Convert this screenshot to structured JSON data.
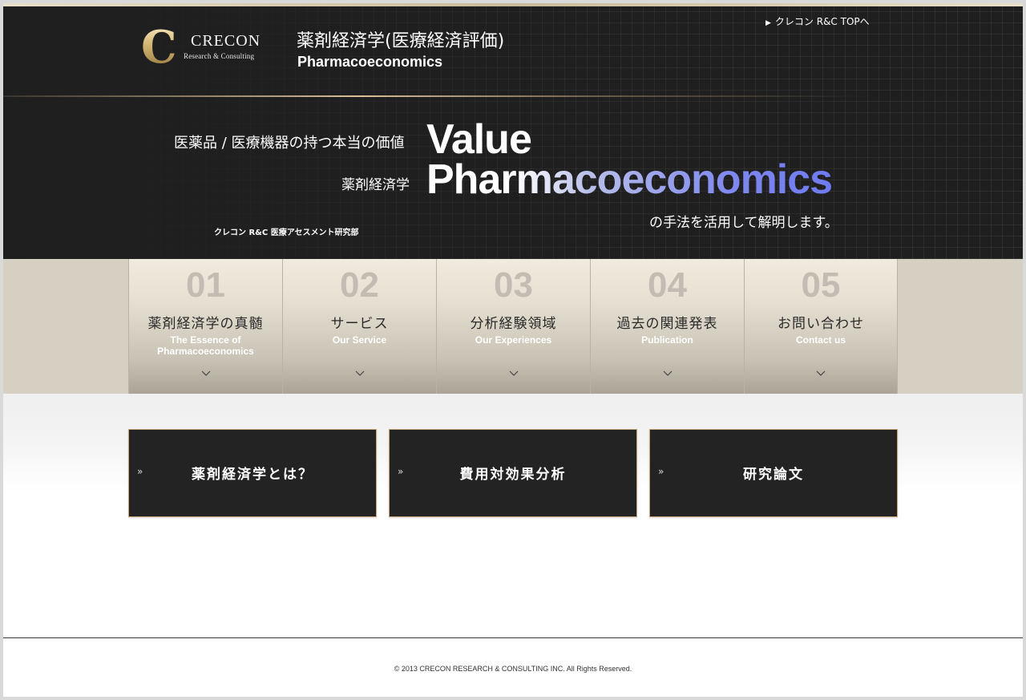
{
  "header": {
    "logo": {
      "name": "CRECON",
      "sub": "Research & Consulting"
    },
    "title_jp": "薬剤経済学(医療経済評価)",
    "title_en": "Pharmacoeconomics",
    "top_link": "クレコン R&C TOPへ"
  },
  "hero": {
    "line1_label": "医薬品 / 医療機器の持つ本当の価値",
    "line1_word": "Value",
    "line2_label": "薬剤経済学",
    "line2_word": "Pharmacoeconomics",
    "method": "の手法を活用して解明します。",
    "department": "クレコン R&C 医療アセスメント研究部"
  },
  "nav": {
    "items": [
      {
        "num": "01",
        "jp": "薬剤経済学の真髄",
        "en": "The Essence of Pharmacoeconomics"
      },
      {
        "num": "02",
        "jp": "サービス",
        "en": "Our Service"
      },
      {
        "num": "03",
        "jp": "分析経験領域",
        "en": "Our Experiences"
      },
      {
        "num": "04",
        "jp": "過去の関連発表",
        "en": "Publication"
      },
      {
        "num": "05",
        "jp": "お問い合わせ",
        "en": "Contact us"
      }
    ]
  },
  "cta": {
    "items": [
      {
        "label": "薬剤経済学とは？"
      },
      {
        "label": "費用対効果分析"
      },
      {
        "label": "研究論文"
      }
    ]
  },
  "footer": {
    "copyright": "© 2013 CRECON RESEARCH & CONSULTING INC. All Rights Reserved."
  },
  "colors": {
    "hero_bg": "#1f1f1f",
    "accent_gold": "#c9a77c",
    "accent_blue": "#6e7af0",
    "nav_bg": "#d6d0c2",
    "cta_bg": "#232323"
  }
}
